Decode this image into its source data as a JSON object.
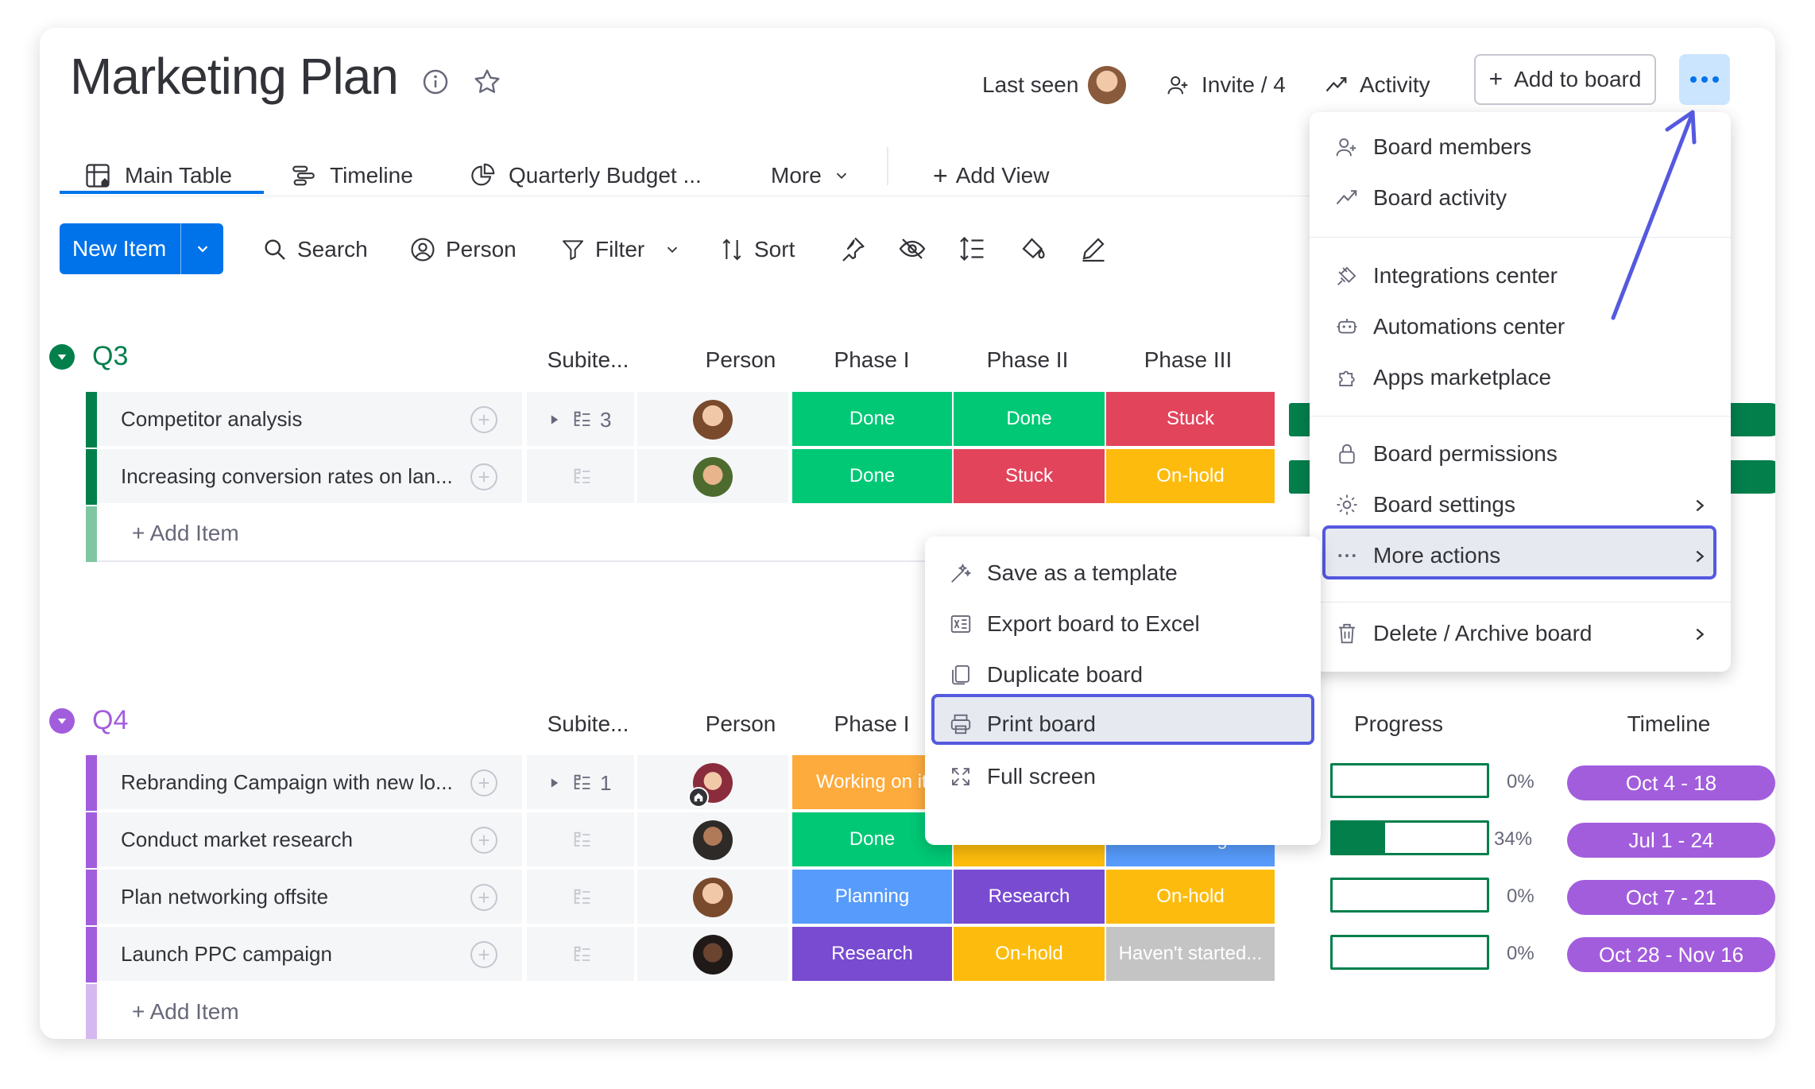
{
  "header": {
    "title": "Marketing Plan",
    "last_seen": "Last seen",
    "invite": "Invite / 4",
    "activity": "Activity",
    "add_to_board": "Add to board",
    "more_dots": "..."
  },
  "tabs": {
    "main_table": "Main Table",
    "timeline": "Timeline",
    "quarterly_budget": "Quarterly Budget ...",
    "more": "More",
    "add_view": "Add View"
  },
  "toolbar": {
    "new_item": "New Item",
    "search": "Search",
    "person": "Person",
    "filter": "Filter",
    "sort": "Sort"
  },
  "columns": {
    "subitems": "Subite...",
    "person": "Person",
    "phase1": "Phase I",
    "phase2": "Phase II",
    "phase3": "Phase III",
    "progress": "Progress",
    "timeline": "Timeline"
  },
  "groups": [
    {
      "name": "Q3",
      "color": "#037f4c",
      "rows": [
        {
          "name": "Competitor analysis",
          "sub_count": "3",
          "p1": "Done",
          "p2": "Done",
          "p3": "Stuck"
        },
        {
          "name": "Increasing conversion rates on lan...",
          "sub_count": "",
          "p1": "Done",
          "p2": "Stuck",
          "p3": "On-hold"
        }
      ],
      "add_item": "+ Add Item"
    },
    {
      "name": "Q4",
      "color": "#a25ddc",
      "rows": [
        {
          "name": "Rebranding Campaign with new lo...",
          "sub_count": "1",
          "p1": "Working on it",
          "p2": "",
          "p3": "",
          "progress": "0%",
          "progress_value": 0,
          "timeline": "Oct 4 - 18"
        },
        {
          "name": "Conduct market research",
          "sub_count": "",
          "p1": "Done",
          "p2": "On-hold",
          "p3": "Planning",
          "progress": "34%",
          "progress_value": 34,
          "timeline": "Jul 1 - 24"
        },
        {
          "name": "Plan networking offsite",
          "sub_count": "",
          "p1": "Planning",
          "p2": "Research",
          "p3": "On-hold",
          "progress": "0%",
          "progress_value": 0,
          "timeline": "Oct 7 - 21"
        },
        {
          "name": "Launch PPC campaign",
          "sub_count": "",
          "p1": "Research",
          "p2": "On-hold",
          "p3": "Haven't started...",
          "progress": "0%",
          "progress_value": 0,
          "timeline": "Oct 28 - Nov 16"
        }
      ],
      "add_item": "+ Add Item"
    }
  ],
  "status_colors": {
    "done": "#00c875",
    "stuck": "#e2445c",
    "onhold": "#fdbc0d",
    "working": "#fdab3d",
    "planning": "#579bfc",
    "research": "#784bd1",
    "not_started": "#c4c4c4"
  },
  "main_menu": {
    "board_members": "Board members",
    "board_activity": "Board activity",
    "integrations_center": "Integrations center",
    "automations_center": "Automations center",
    "apps_marketplace": "Apps marketplace",
    "board_permissions": "Board permissions",
    "board_settings": "Board settings",
    "more_actions": "More actions",
    "delete_archive": "Delete / Archive board"
  },
  "submenu": {
    "save_template": "Save as a template",
    "export_excel": "Export board to Excel",
    "duplicate": "Duplicate board",
    "print": "Print board",
    "full_screen": "Full screen"
  },
  "accent": "#5559df"
}
